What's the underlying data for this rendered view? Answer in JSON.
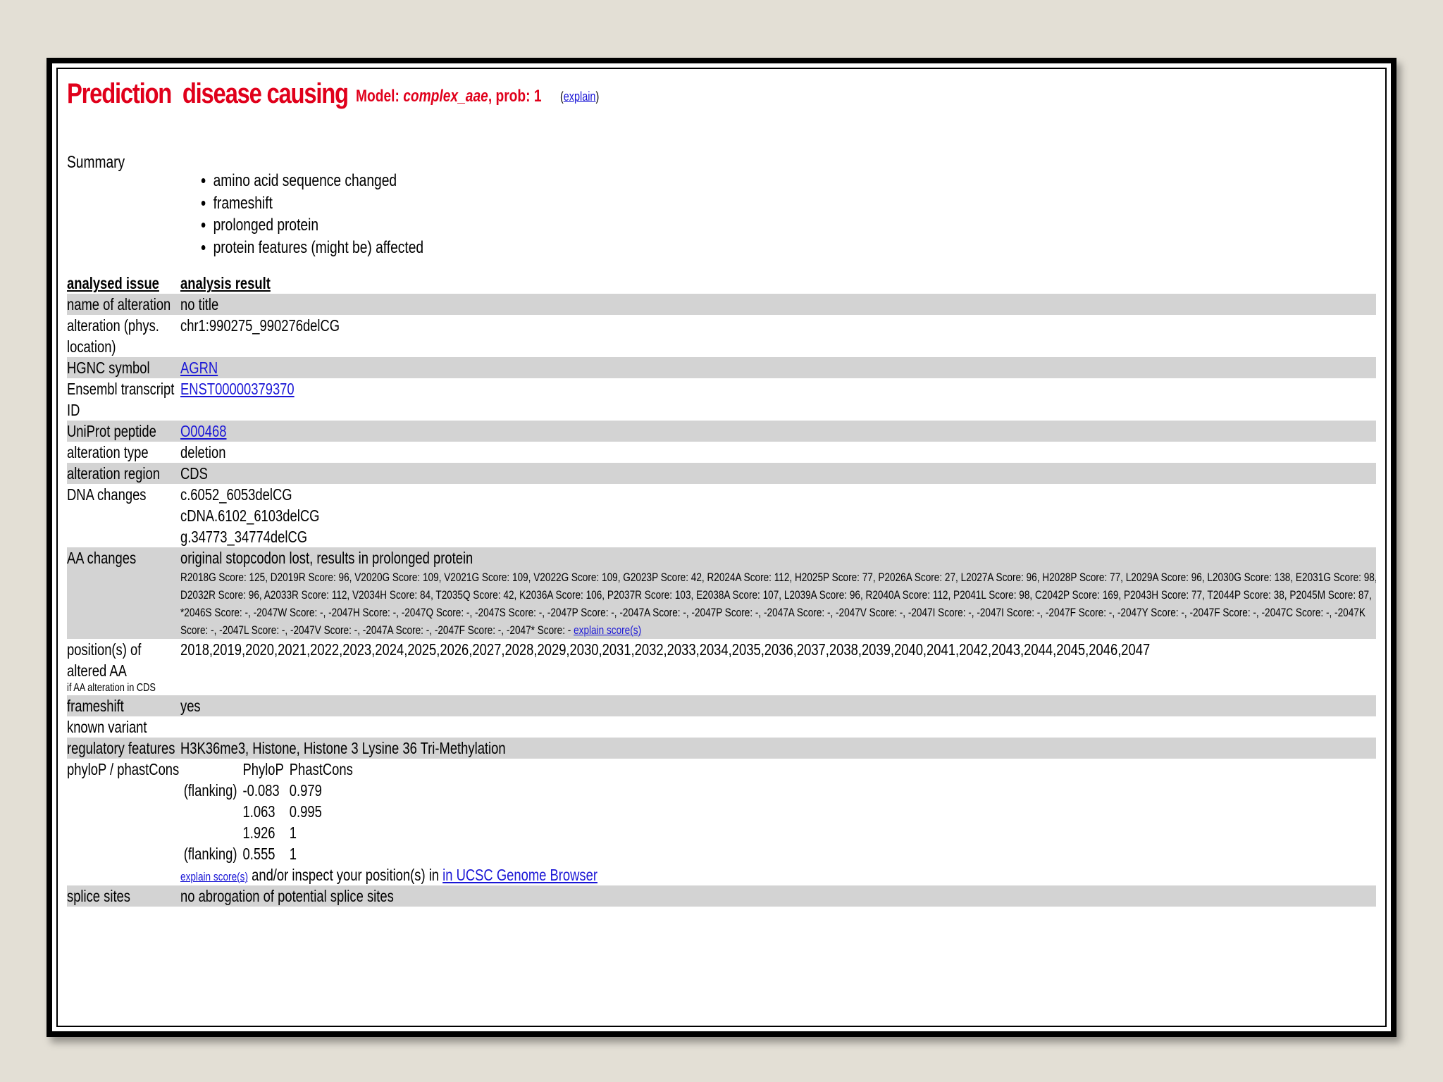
{
  "header": {
    "prediction_label": "Prediction",
    "prediction_value": "disease causing",
    "model_prefix": "Model: ",
    "model_name": "complex_aae",
    "model_suffix": ", prob: 1",
    "explain_link": "explain"
  },
  "summary": {
    "label": "Summary",
    "items": [
      "amino acid sequence changed",
      "frameshift",
      "prolonged protein",
      "protein features (might be) affected"
    ]
  },
  "table": {
    "headers": {
      "issue": "analysed issue",
      "result": "analysis result"
    },
    "rows": {
      "name_of_alteration": {
        "label": "name of alteration",
        "value": "no title"
      },
      "alteration_location": {
        "label": "alteration (phys. location)",
        "value": "chr1:990275_990276delCG"
      },
      "hgnc_symbol": {
        "label": "HGNC symbol",
        "value": "AGRN"
      },
      "ensembl_transcript": {
        "label": "Ensembl transcript ID",
        "value": "ENST00000379370"
      },
      "uniprot_peptide": {
        "label": "UniProt peptide",
        "value": "O00468"
      },
      "alteration_type": {
        "label": "alteration type",
        "value": "deletion"
      },
      "alteration_region": {
        "label": "alteration region",
        "value": "CDS"
      },
      "dna_changes": {
        "label": "DNA changes",
        "values": [
          "c.6052_6053delCG",
          "cDNA.6102_6103delCG",
          "g.34773_34774delCG"
        ]
      },
      "aa_changes": {
        "label": "AA changes",
        "main": "original stopcodon lost, results in prolonged protein",
        "scores": "R2018G Score: 125, D2019R Score: 96, V2020G Score: 109, V2021G Score: 109, V2022G Score: 109, G2023P Score: 42, R2024A Score: 112, H2025P Score: 77, P2026A Score: 27, L2027A Score: 96, H2028P Score: 77, L2029A Score: 96, L2030G Score: 138, E2031G Score: 98, D2032R Score: 96, A2033R Score: 112, V2034H Score: 84, T2035Q Score: 42, K2036A Score: 106, P2037R Score: 103, E2038A Score: 107, L2039A Score: 96, R2040A Score: 112, P2041L Score: 98, C2042P Score: 169, P2043H Score: 77, T2044P Score: 38, P2045M Score: 87, *2046S Score: -, -2047W Score: -, -2047H Score: -, -2047Q Score: -, -2047S Score: -, -2047P Score: -, -2047A Score: -, -2047P Score: -, -2047A Score: -, -2047V Score: -, -2047I Score: -, -2047I Score: -, -2047F Score: -, -2047Y Score: -, -2047F Score: -, -2047C Score: -, -2047K Score: -, -2047L Score: -, -2047V Score: -, -2047A Score: -, -2047F Score: -, -2047* Score: - ",
        "scores_link": "explain score(s)"
      },
      "positions": {
        "label": "position(s) of altered AA",
        "note": "if AA alteration in CDS",
        "value": "2018,2019,2020,2021,2022,2023,2024,2025,2026,2027,2028,2029,2030,2031,2032,2033,2034,2035,2036,2037,2038,2039,2040,2041,2042,2043,2044,2045,2046,2047"
      },
      "frameshift": {
        "label": "frameshift",
        "value": "yes"
      },
      "known_variant": {
        "label": "known variant",
        "value": ""
      },
      "regulatory_features": {
        "label": "regulatory features",
        "value": "H3K36me3, Histone, Histone 3 Lysine 36 Tri-Methylation"
      },
      "conservation": {
        "label": "phyloP / phastCons",
        "col_phylop": "PhyloP",
        "col_phastcons": "PhastCons",
        "rows": [
          {
            "tag": "(flanking)",
            "phylop": "-0.083",
            "phastcons": "0.979"
          },
          {
            "tag": "",
            "phylop": "1.063",
            "phastcons": "0.995"
          },
          {
            "tag": "",
            "phylop": "1.926",
            "phastcons": "1"
          },
          {
            "tag": "(flanking)",
            "phylop": "0.555",
            "phastcons": "1"
          }
        ],
        "explain_link": "explain score(s)",
        "middle_text": " and/or inspect your position(s) in ",
        "ucsc_link": "in UCSC Genome Browser"
      },
      "splice_sites": {
        "label": "splice sites",
        "value": "no abrogation of potential splice sites"
      }
    }
  }
}
